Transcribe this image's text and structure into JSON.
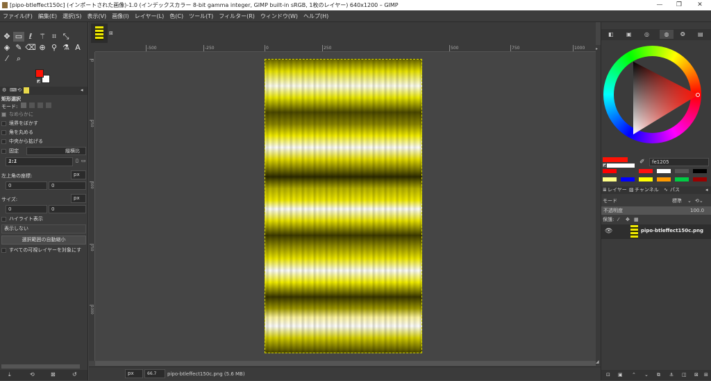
{
  "window": {
    "title": "[pipo-btleffect150c] (インポートされた画像)-1.0 (インデックスカラー 8-bit gamma integer, GIMP built-in sRGB, 1枚のレイヤー) 640x1200 – GIMP",
    "minimize": "—",
    "maximize": "❐",
    "close": "✕"
  },
  "menu": [
    "ファイル(F)",
    "編集(E)",
    "選択(S)",
    "表示(V)",
    "画像(I)",
    "レイヤー(L)",
    "色(C)",
    "ツール(T)",
    "フィルター(R)",
    "ウィンドウ(W)",
    "ヘルプ(H)"
  ],
  "tools": {
    "row1": [
      {
        "name": "move-tool-icon",
        "glyph": "✥"
      },
      {
        "name": "rect-select-tool-icon",
        "glyph": "▭"
      },
      {
        "name": "lasso-tool-icon",
        "glyph": "ℓ"
      },
      {
        "name": "fuzzy-select-tool-icon",
        "glyph": "⚚"
      },
      {
        "name": "crop-tool-icon",
        "glyph": "⌗"
      },
      {
        "name": "unified-transform-tool-icon",
        "glyph": "⤡"
      }
    ],
    "row2": [
      {
        "name": "bucket-fill-tool-icon",
        "glyph": "◈"
      },
      {
        "name": "paintbrush-tool-icon",
        "glyph": "✎"
      },
      {
        "name": "eraser-tool-icon",
        "glyph": "⌫"
      },
      {
        "name": "clone-tool-icon",
        "glyph": "⊕"
      },
      {
        "name": "dodge-tool-icon",
        "glyph": "⚲"
      },
      {
        "name": "warp-tool-icon",
        "glyph": "⚗"
      },
      {
        "name": "text-tool-icon",
        "glyph": "A"
      }
    ],
    "row3": [
      {
        "name": "color-picker-tool-icon",
        "glyph": "⁄"
      },
      {
        "name": "zoom-tool-icon",
        "glyph": "⌕"
      }
    ]
  },
  "colors": {
    "fg": "#fe1205",
    "bg": "#ffffff",
    "image_yellow": "#f0ea00"
  },
  "tool_options": {
    "tab_title": "矩形選択",
    "mode_label": "モード:",
    "antialias": "なめらかに",
    "feather": "境界をぼかす",
    "rounded": "角を丸める",
    "expand_center": "中央から拡げる",
    "fixed_label": "固定",
    "fixed_value": "縦横比",
    "ratio_value": "1:1",
    "pos_label": "左上角の座標:",
    "pos_unit": "px",
    "pos_x": "0",
    "pos_y": "0",
    "size_label": "サイズ:",
    "size_unit": "px",
    "size_w": "0",
    "size_h": "0",
    "highlight": "ハイライト表示",
    "guides_value": "表示しない",
    "autoshrink_button": "選択範囲の自動縮小",
    "visible_layers": "すべての可視レイヤーを対象にす"
  },
  "rulers": {
    "h": [
      "-500",
      "-250",
      "0",
      "250",
      "500",
      "750",
      "1000",
      "1250"
    ],
    "v": [
      "0",
      "250",
      "500",
      "750",
      "1000"
    ]
  },
  "status": {
    "unit": "px",
    "zoom": "66.7",
    "info": "pipo-btleffect150c.png (5.6 MB)"
  },
  "right": {
    "hex_value": "fe1205",
    "palette": [
      "#ff0000",
      "#3a3a3a",
      "#ff1111",
      "#ffffff",
      "#555555",
      "#000000",
      "#ffff88",
      "#0000ff",
      "#ffff00",
      "#ff9900",
      "#00cc44",
      "#990000"
    ],
    "tabs_label": "レイヤー",
    "channels_label": "チャンネル",
    "paths_label": "パス",
    "mode_label": "モード",
    "mode_value": "標準",
    "opacity_label": "不透明度",
    "opacity_value": "100.0",
    "lock_label": "保護:",
    "layer_name": "pipo-btleffect150c.png"
  }
}
